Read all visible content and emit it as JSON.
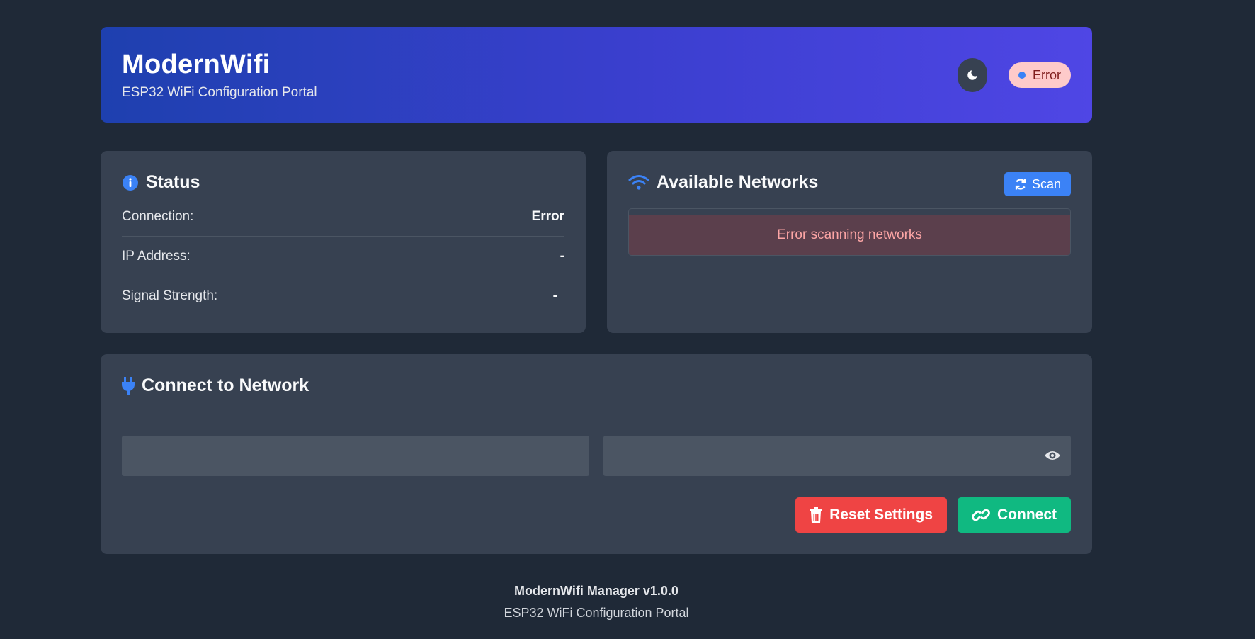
{
  "header": {
    "title": "ModernWifi",
    "subtitle": "ESP32 WiFi Configuration Portal",
    "theme_icon": "moon-icon",
    "status_badge": "Error"
  },
  "status": {
    "title": "Status",
    "rows": [
      {
        "label": "Connection:",
        "value": "Error"
      },
      {
        "label": "IP Address:",
        "value": "-"
      },
      {
        "label": "Signal Strength:",
        "value": "-"
      }
    ]
  },
  "networks": {
    "title": "Available Networks",
    "scan_label": "Scan",
    "error_text": "Error scanning networks"
  },
  "connect": {
    "title": "Connect to Network",
    "ssid_value": "",
    "password_value": "",
    "reset_label": "Reset Settings",
    "connect_label": "Connect"
  },
  "footer": {
    "line1": "ModernWifi Manager v1.0.0",
    "line2": "ESP32 WiFi Configuration Portal"
  },
  "colors": {
    "background": "#1f2937",
    "card": "#374151",
    "accent": "#3b82f6",
    "danger": "#ef4444",
    "success": "#10b981"
  }
}
